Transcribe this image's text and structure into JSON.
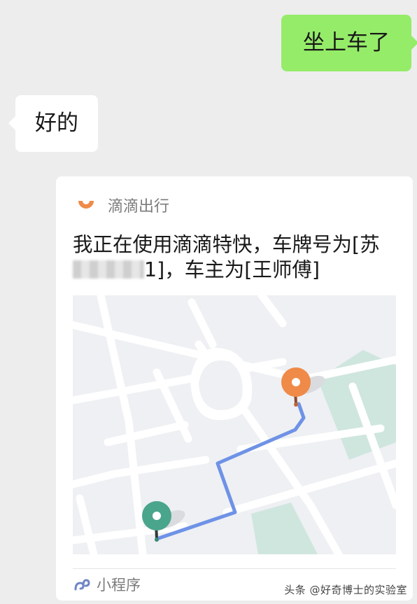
{
  "messages": {
    "outgoing_text": "坐上车了",
    "incoming_text": "好的"
  },
  "share_card": {
    "app_name": "滴滴出行",
    "text_before_plate": "我正在使用滴滴特快，车牌号为[苏",
    "plate_visible_tail": "1",
    "text_after_plate": "]，车主为[王师傅]",
    "footer_label": "小程序",
    "brand_color": "#f08a48",
    "start_pin_color": "#4aa58d",
    "route_color": "#6e92e6"
  },
  "watermark": "头条 @好奇博士的实验室"
}
